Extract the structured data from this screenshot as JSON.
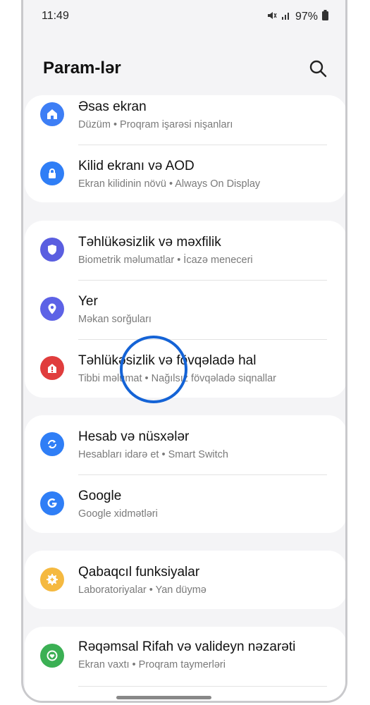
{
  "status": {
    "time": "11:49",
    "battery": "97%"
  },
  "header": {
    "title": "Param-lər"
  },
  "groups": [
    [
      {
        "title": "Əsas ekran",
        "subtitle": "Düzüm  •  Proqram işarəsi nişanları",
        "icon": "home-icon",
        "color": "#3d7ef5"
      },
      {
        "title": "Kilid ekranı və AOD",
        "subtitle": "Ekran kilidinin növü  •  Always On Display",
        "icon": "lock-icon",
        "color": "#2f7ef6"
      }
    ],
    [
      {
        "title": "Təhlükəsizlik və məxfilik",
        "subtitle": "Biometrik məlumatlar  •  İcazə meneceri",
        "icon": "shield-icon",
        "color": "#5a5ee0"
      },
      {
        "title": "Yer",
        "subtitle": "Məkan sorğuları",
        "icon": "location-icon",
        "color": "#5d62e6"
      },
      {
        "title": "Təhlükəsizlik və fövqəladə hal",
        "subtitle": "Tibbi məlumat  •  Nağılsız fövqəladə siqnallar",
        "icon": "emergency-icon",
        "color": "#e03d3d"
      }
    ],
    [
      {
        "title": "Hesab və nüsxələr",
        "subtitle": "Hesabları idarə et  •  Smart Switch",
        "icon": "sync-icon",
        "color": "#2f7ef6"
      },
      {
        "title": "Google",
        "subtitle": "Google xidmətləri",
        "icon": "google-icon",
        "color": "#2f7ef6"
      }
    ],
    [
      {
        "title": "Qabaqcıl funksiyalar",
        "subtitle": "Laboratoriyalar  •  Yan düymə",
        "icon": "gear-plus-icon",
        "color": "#f5b940"
      }
    ],
    [
      {
        "title": "Rəqəmsal Rifah və valideyn nəzarəti",
        "subtitle": "Ekran vaxtı  •  Proqram taymerləri",
        "icon": "wellbeing-icon",
        "color": "#3bb054"
      }
    ]
  ]
}
